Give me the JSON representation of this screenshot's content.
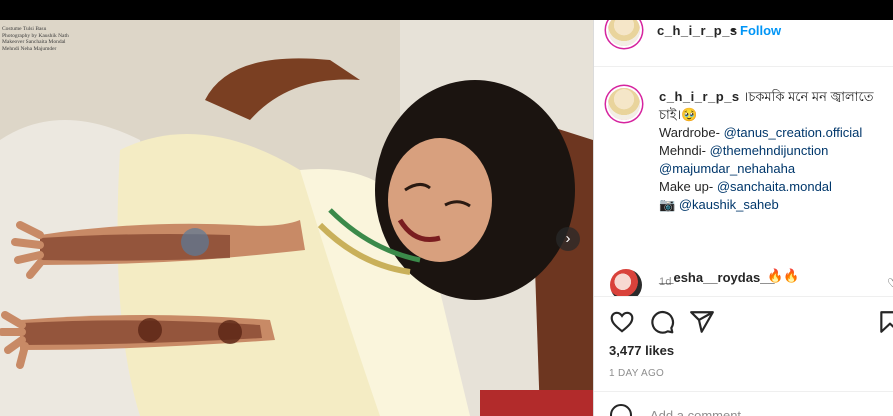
{
  "post": {
    "username": "c_h_i_r_p_s",
    "separator": "•",
    "follow_label": "Follow",
    "image_credits": "Costume Tulsi Basu\nPhotography by Kaushik Nath\nMakeover Sanchaita Mondal\nMehndi Neha Majumder",
    "caption": {
      "username": "c_h_i_r_p_s",
      "title": "।চকমকি মনে মন জ্বালাতে চাই।🥹",
      "wardrobe_label": "Wardrobe-",
      "wardrobe_handle": "@tanus_creation.official",
      "mehndi_label": "Mehndi-",
      "mehndi_handle_1": "@themehndijunction",
      "mehndi_handle_2": "@majumdar_nehahaha",
      "makeup_label": "Make up-",
      "makeup_handle": "@sanchaita.mondal",
      "photo_label": "📷",
      "photo_handle": "@kaushik_saheb",
      "age": "1d"
    },
    "comment": {
      "username": "__esha__roydas__",
      "emoji": "🔥🔥"
    },
    "likes": "3,477 likes",
    "posted": "1 DAY AGO",
    "add_comment_placeholder": "Add a comment..."
  },
  "icons": {
    "next": "chevron-right-icon",
    "like": "heart-icon",
    "comment": "comment-icon",
    "share": "paper-plane-icon",
    "save": "bookmark-icon",
    "emoji": "smiley-icon"
  },
  "colors": {
    "accent": "#0095f6",
    "link": "#00376b",
    "muted": "#8e8e8e",
    "text": "#262626"
  }
}
